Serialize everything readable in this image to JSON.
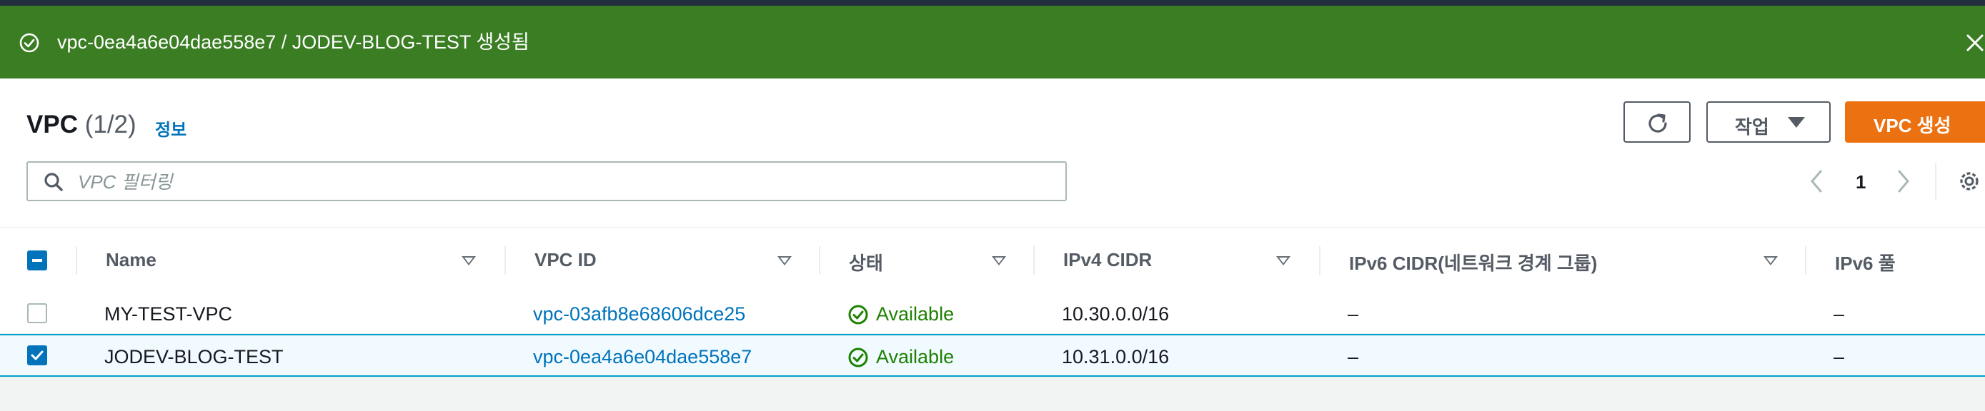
{
  "flash": {
    "message": "vpc-0ea4a6e04dae558e7 / JODEV-BLOG-TEST 생성됨",
    "icon": "success-circle-icon",
    "color": "#3b7d23"
  },
  "header": {
    "title": "VPC",
    "count": "(1/2)",
    "info_label": "정보"
  },
  "toolbar": {
    "refresh_icon": "refresh-icon",
    "actions_label": "작업",
    "create_label": "VPC 생성",
    "create_color": "#ec7211"
  },
  "search": {
    "placeholder": "VPC 필터링",
    "value": ""
  },
  "pagination": {
    "current_page": "1"
  },
  "table": {
    "columns": [
      "Name",
      "VPC ID",
      "상태",
      "IPv4 CIDR",
      "IPv6 CIDR(네트워크 경계 그룹)",
      "IPv6 풀"
    ],
    "rows": [
      {
        "selected": false,
        "name": "MY-TEST-VPC",
        "vpc_id": "vpc-03afb8e68606dce25",
        "status": "Available",
        "ipv4_cidr": "10.30.0.0/16",
        "ipv6_cidr": "–",
        "ipv6_pool": "–"
      },
      {
        "selected": true,
        "name": "JODEV-BLOG-TEST",
        "vpc_id": "vpc-0ea4a6e04dae558e7",
        "status": "Available",
        "ipv4_cidr": "10.31.0.0/16",
        "ipv6_cidr": "–",
        "ipv6_pool": "–"
      }
    ]
  },
  "colors": {
    "link": "#0073bb",
    "status_ok": "#1d8102",
    "selected_row": "#f1faff"
  }
}
